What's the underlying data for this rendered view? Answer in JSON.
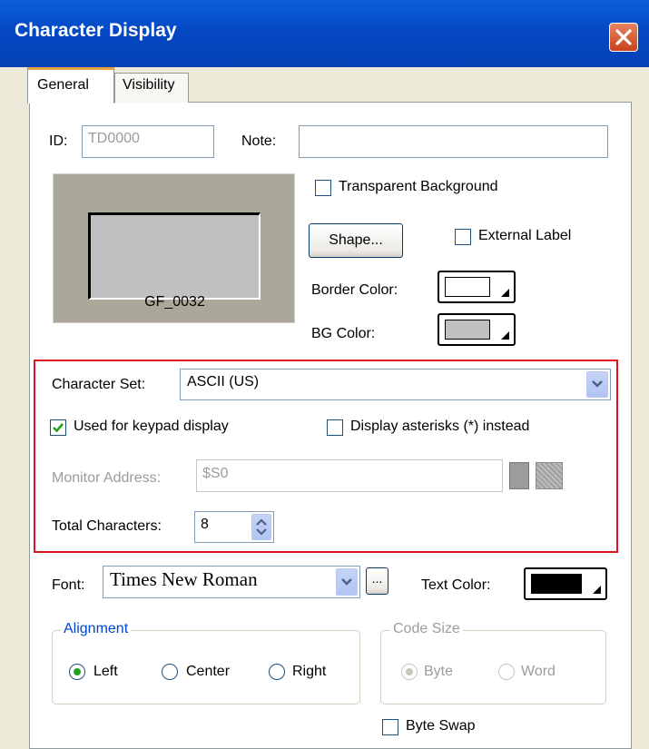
{
  "window": {
    "title": "Character Display"
  },
  "tabs": [
    {
      "label": "General"
    },
    {
      "label": "Visibility"
    }
  ],
  "general": {
    "id_label": "ID:",
    "id_value": "TD0000",
    "note_label": "Note:",
    "note_value": "",
    "preview_caption": "GF_0032",
    "transparent_bg_label": "Transparent Background",
    "transparent_bg_checked": false,
    "shape_button": "Shape...",
    "external_label_label": "External Label",
    "external_label_checked": false,
    "border_color_label": "Border Color:",
    "border_color": "#FFFFFF",
    "bg_color_label": "BG Color:",
    "bg_color": "#C0C0C0",
    "charset_label": "Character Set:",
    "charset_value": "ASCII (US)",
    "keypad_label": "Used for keypad display",
    "keypad_checked": true,
    "asterisks_label": "Display asterisks (*) instead",
    "asterisks_checked": false,
    "monitor_label": "Monitor Address:",
    "monitor_value": "$S0",
    "total_chars_label": "Total Characters:",
    "total_chars_value": "8",
    "font_label": "Font:",
    "font_value": "Times New Roman",
    "font_more_button": "...",
    "text_color_label": "Text Color:",
    "text_color": "#000000",
    "alignment": {
      "title": "Alignment",
      "options": [
        "Left",
        "Center",
        "Right"
      ],
      "selected": "Left"
    },
    "code_size": {
      "title": "Code Size",
      "options": [
        "Byte",
        "Word"
      ],
      "selected": "Byte",
      "enabled": false
    },
    "byte_swap_label": "Byte Swap",
    "byte_swap_checked": false
  },
  "colors": {
    "highlight_box": "#E0141E",
    "titlebar": "#0548C4",
    "tab_accent": "#E6A23C",
    "check_mark": "#21A121"
  }
}
